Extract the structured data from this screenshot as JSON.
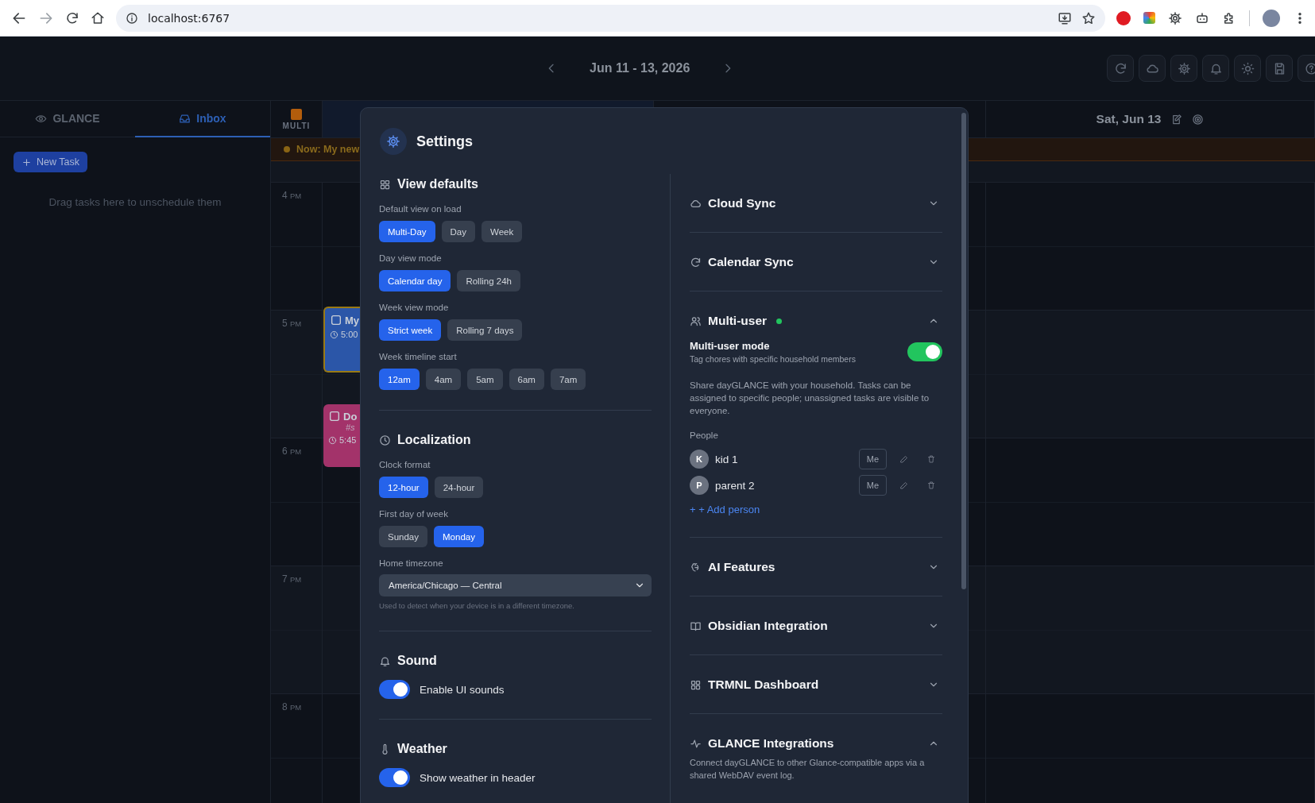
{
  "browser": {
    "url": "localhost:6767"
  },
  "header": {
    "date_range": "Jun 11 - 13, 2026"
  },
  "sidebar": {
    "tabs": [
      {
        "label": "GLANCE",
        "selected": false
      },
      {
        "label": "Inbox",
        "selected": true
      }
    ],
    "new_task": "New Task",
    "empty_text": "Drag tasks here to unschedule them"
  },
  "calendar": {
    "multi_label": "MULTI",
    "now_banner": "Now: My new",
    "day_header": "Sat, Jun 13",
    "hours": [
      {
        "hour": "4",
        "period": "PM"
      },
      {
        "hour": "5",
        "period": "PM"
      },
      {
        "hour": "6",
        "period": "PM"
      },
      {
        "hour": "7",
        "period": "PM"
      },
      {
        "hour": "8",
        "period": "PM"
      }
    ],
    "events": [
      {
        "title": "My",
        "time": "5:00",
        "color": "#2b56a8",
        "current": true
      },
      {
        "title": "Do",
        "tag": "#s",
        "time": "5:45",
        "color": "#a3336a",
        "current": false
      }
    ]
  },
  "settings": {
    "title": "Settings",
    "left_sections": [
      {
        "title": "View defaults",
        "groups": [
          {
            "label": "Default view on load",
            "options": [
              {
                "label": "Multi-Day",
                "selected": true
              },
              {
                "label": "Day",
                "selected": false
              },
              {
                "label": "Week",
                "selected": false
              }
            ]
          },
          {
            "label": "Day view mode",
            "options": [
              {
                "label": "Calendar day",
                "selected": true
              },
              {
                "label": "Rolling 24h",
                "selected": false
              }
            ]
          },
          {
            "label": "Week view mode",
            "options": [
              {
                "label": "Strict week",
                "selected": true
              },
              {
                "label": "Rolling 7 days",
                "selected": false
              }
            ]
          },
          {
            "label": "Week timeline start",
            "options": [
              {
                "label": "12am",
                "selected": true
              },
              {
                "label": "4am",
                "selected": false
              },
              {
                "label": "5am",
                "selected": false
              },
              {
                "label": "6am",
                "selected": false
              },
              {
                "label": "7am",
                "selected": false
              }
            ]
          }
        ]
      },
      {
        "title": "Localization",
        "groups": [
          {
            "label": "Clock format",
            "options": [
              {
                "label": "12-hour",
                "selected": true
              },
              {
                "label": "24-hour",
                "selected": false
              }
            ]
          },
          {
            "label": "First day of week",
            "options": [
              {
                "label": "Sunday",
                "selected": false
              },
              {
                "label": "Monday",
                "selected": true
              }
            ]
          }
        ],
        "select": {
          "label": "Home timezone",
          "value": "America/Chicago — Central",
          "hint": "Used to detect when your device is in a different timezone."
        }
      },
      {
        "title": "Sound",
        "toggles": [
          {
            "label": "Enable UI sounds",
            "on": true
          }
        ]
      },
      {
        "title": "Weather",
        "toggles": [
          {
            "label": "Show weather in header",
            "on": true
          }
        ]
      }
    ],
    "right_sections": [
      {
        "title": "Cloud Sync",
        "expanded": false,
        "active": false
      },
      {
        "title": "Calendar Sync",
        "expanded": false,
        "active": false
      },
      {
        "title": "Multi-user",
        "expanded": true,
        "active": true,
        "content": {
          "mode": {
            "title": "Multi-user mode",
            "subtitle": "Tag chores with specific household members",
            "on": true
          },
          "description": "Share dayGLANCE with your household. Tasks can be assigned to specific people; unassigned tasks are visible to everyone.",
          "people_label": "People",
          "people": [
            {
              "initial": "K",
              "name": "kid 1",
              "me_button": "Me"
            },
            {
              "initial": "P",
              "name": "parent 2",
              "me_button": "Me"
            }
          ],
          "add_person": "+ + Add person"
        }
      },
      {
        "title": "AI Features",
        "expanded": false,
        "active": false
      },
      {
        "title": "Obsidian Integration",
        "expanded": false,
        "active": false
      },
      {
        "title": "TRMNL Dashboard",
        "expanded": false,
        "active": false
      },
      {
        "title": "GLANCE Integrations",
        "expanded": true,
        "active": false,
        "content": {
          "description": "Connect dayGLANCE to other Glance-compatible apps via a shared WebDAV event log."
        }
      }
    ]
  }
}
